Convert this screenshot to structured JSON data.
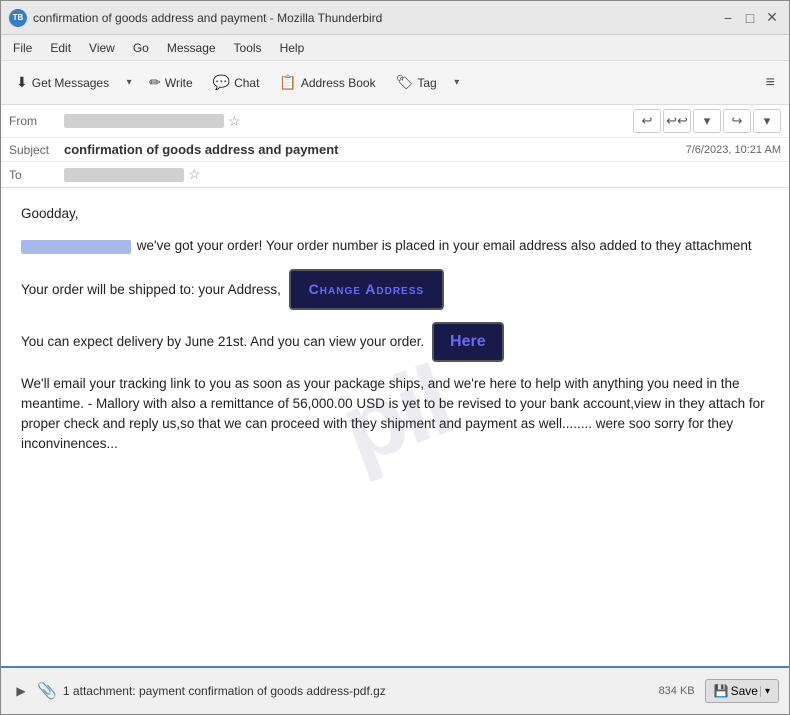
{
  "window": {
    "title": "confirmation of goods address and payment - Mozilla Thunderbird",
    "icon": "TB"
  },
  "title_controls": {
    "minimize": "−",
    "maximize": "□",
    "close": "✕"
  },
  "menu": {
    "items": [
      "File",
      "Edit",
      "View",
      "Go",
      "Message",
      "Tools",
      "Help"
    ]
  },
  "toolbar": {
    "get_messages_label": "Get Messages",
    "write_label": "Write",
    "chat_label": "Chat",
    "address_book_label": "Address Book",
    "tag_label": "Tag",
    "hamburger": "≡"
  },
  "header": {
    "from_label": "From",
    "subject_label": "Subject",
    "subject_value": "confirmation of goods address and payment",
    "date": "7/6/2023, 10:21 AM",
    "to_label": "To",
    "reply_icon": "↩",
    "reply_all_icon": "↩↩",
    "forward_icon": "↪",
    "more_icon": "▾"
  },
  "body": {
    "greeting": "Goodday,",
    "line1_suffix": " we've got your order! Your order number is placed in your email address also added to they attachment",
    "line2_prefix": "Your order will be shipped to: your Address,",
    "change_address_label": "Change Address",
    "line3_prefix": "You can expect delivery by June 21st. And you can view your order.",
    "here_label": "Here",
    "line4": "We'll email your tracking link to you as soon as your package ships, and we're here to help with anything you need in the meantime. - Mallory with also a remittance of 56,000.00 USD is yet to be revised to your bank account,view in they attach for proper check and reply us,so that we  can proceed with they shipment and payment as well........ were soo sorry for they inconvinences..."
  },
  "footer": {
    "attachment_count": "1 attachment:",
    "attachment_name": "payment confirmation of goods address-pdf.gz",
    "attachment_size": "834 KB",
    "save_label": "Save"
  },
  "watermark": "pil"
}
